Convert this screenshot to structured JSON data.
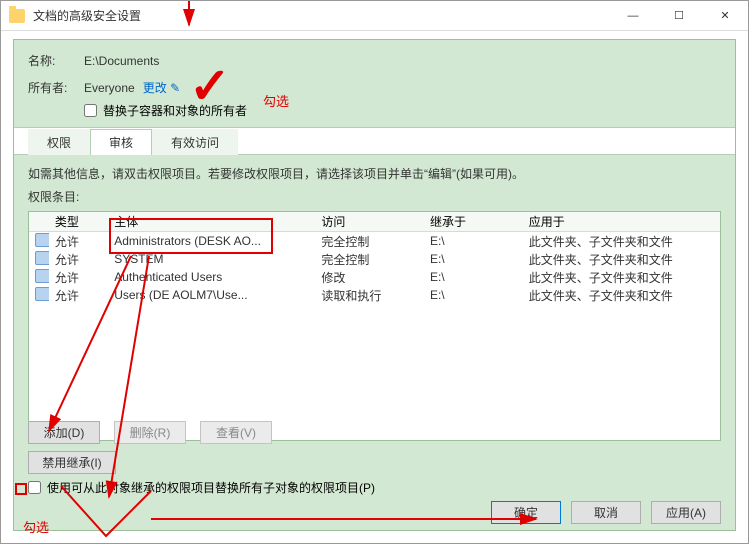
{
  "title": "文档的高级安全设置",
  "name": {
    "label": "名称:",
    "value": "E:\\Documents"
  },
  "owner": {
    "label": "所有者:",
    "value": "Everyone",
    "change_label": "更改"
  },
  "replace_owner_checkbox": "替换子容器和对象的所有者",
  "tabs": {
    "perm": "权限",
    "audit": "审核",
    "effective": "有效访问"
  },
  "info_text": "如需其他信息，请双击权限项目。若要修改权限项目，请选择该项目并单击“编辑”(如果可用)。",
  "entries_label": "权限条目:",
  "columns": {
    "type": "类型",
    "principal": "主体",
    "access": "访问",
    "inherit": "继承于",
    "applies": "应用于"
  },
  "rows": [
    {
      "type": "允许",
      "principal": "Administrators (DESK        AO...",
      "access": "完全控制",
      "inherit": "E:\\",
      "applies": "此文件夹、子文件夹和文件"
    },
    {
      "type": "允许",
      "principal": "SYSTEM",
      "access": "完全控制",
      "inherit": "E:\\",
      "applies": "此文件夹、子文件夹和文件"
    },
    {
      "type": "允许",
      "principal": "Authenticated Users",
      "access": "修改",
      "inherit": "E:\\",
      "applies": "此文件夹、子文件夹和文件"
    },
    {
      "type": "允许",
      "principal": "Users (DE            AOLM7\\Use...",
      "access": "读取和执行",
      "inherit": "E:\\",
      "applies": "此文件夹、子文件夹和文件"
    }
  ],
  "buttons": {
    "add": "添加(D)",
    "remove": "删除(R)",
    "view": "查看(V)",
    "disable_inherit": "禁用继承(I)",
    "ok": "确定",
    "cancel": "取消",
    "apply": "应用(A)"
  },
  "replace_child_checkbox": "使用可从此对象继承的权限项目替换所有子对象的权限项目(P)",
  "annotations": {
    "select": "勾选",
    "select2": "勾选"
  }
}
